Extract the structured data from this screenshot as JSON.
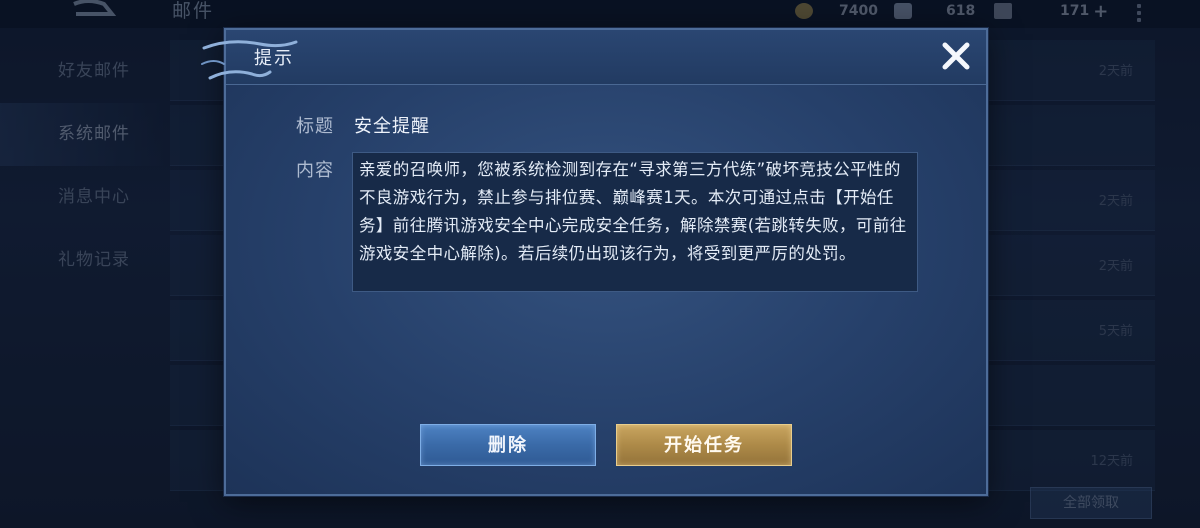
{
  "topbar": {
    "page_title": "邮件",
    "resources": [
      {
        "icon": "gold-coin-icon",
        "value": "7400"
      },
      {
        "icon": "diamond-icon",
        "value": "618"
      },
      {
        "icon": "voucher-icon",
        "value": "171"
      }
    ]
  },
  "sidebar": {
    "items": [
      {
        "label": "好友邮件"
      },
      {
        "label": "系统邮件"
      },
      {
        "label": "消息中心"
      },
      {
        "label": "礼物记录"
      }
    ]
  },
  "mail_list": {
    "times": [
      "2天前",
      "",
      "2天前",
      "2天前",
      "5天前",
      "",
      "12天前"
    ],
    "bottom_button": "全部领取"
  },
  "dialog": {
    "title": "提示",
    "subject_label": "标题",
    "subject": "安全提醒",
    "content_label": "内容",
    "content": "亲爱的召唤师，您被系统检测到存在“寻求第三方代练”破坏竞技公平性的不良游戏行为，禁止参与排位赛、巅峰赛1天。本次可通过点击【开始任务】前往腾讯游戏安全中心完成安全任务，解除禁赛(若跳转失败，可前往游戏安全中心解除)。若后续仍出现该行为，将受到更严厉的处罚。",
    "delete_button": "删除",
    "start_button": "开始任务"
  },
  "colors": {
    "dialog_bg": "#26406a",
    "delete_button": "#3a6aa8",
    "start_button": "#ad8a48"
  }
}
